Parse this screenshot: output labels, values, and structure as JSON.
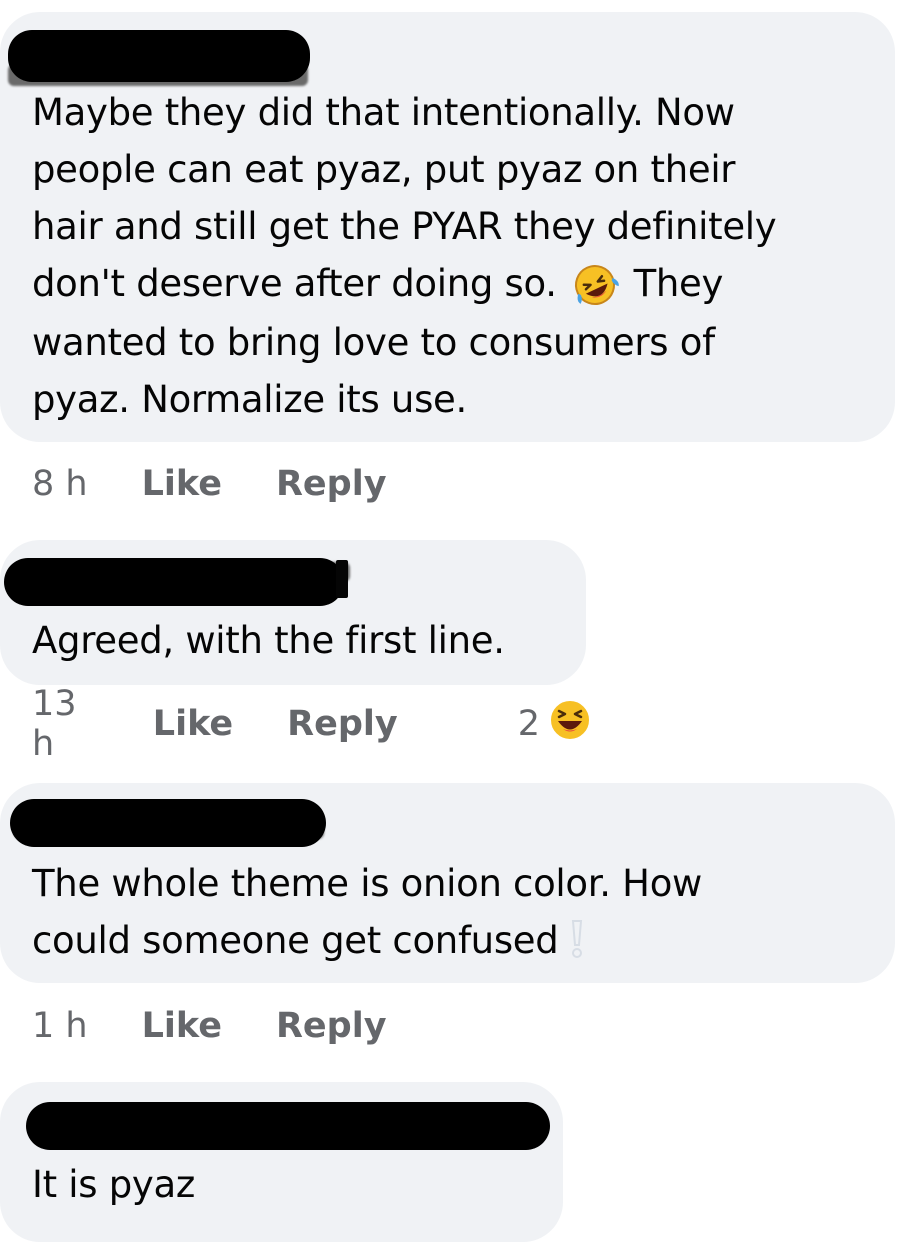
{
  "comments": [
    {
      "author": "",
      "text_parts": [
        "Maybe they did that intentionally. Now\npeople can eat pyaz, put pyaz on their\nhair and still get the PYAR they definitely\ndon't deserve after doing so. ",
        " They\nwanted to bring love to consumers of\npyaz. Normalize its use."
      ],
      "inline_emoji": "rofl-emoji",
      "time": "8 h",
      "like_label": "Like",
      "reply_label": "Reply"
    },
    {
      "author": "",
      "text": "Agreed, with the first line.",
      "time": "13 h",
      "like_label": "Like",
      "reply_label": "Reply",
      "reaction_count": "2",
      "reaction_icon": "laughing-emoji"
    },
    {
      "author": "",
      "text": "The whole theme is onion color. How\ncould someone get confused",
      "trailing_icon": "exclamation-icon",
      "time": "1 h",
      "like_label": "Like",
      "reply_label": "Reply"
    },
    {
      "author": "",
      "text": "It is pyaz"
    }
  ],
  "colors": {
    "bubble": "#f0f2f5",
    "meta_text": "#65676b",
    "body_text": "#050505",
    "redaction": "#000000"
  }
}
